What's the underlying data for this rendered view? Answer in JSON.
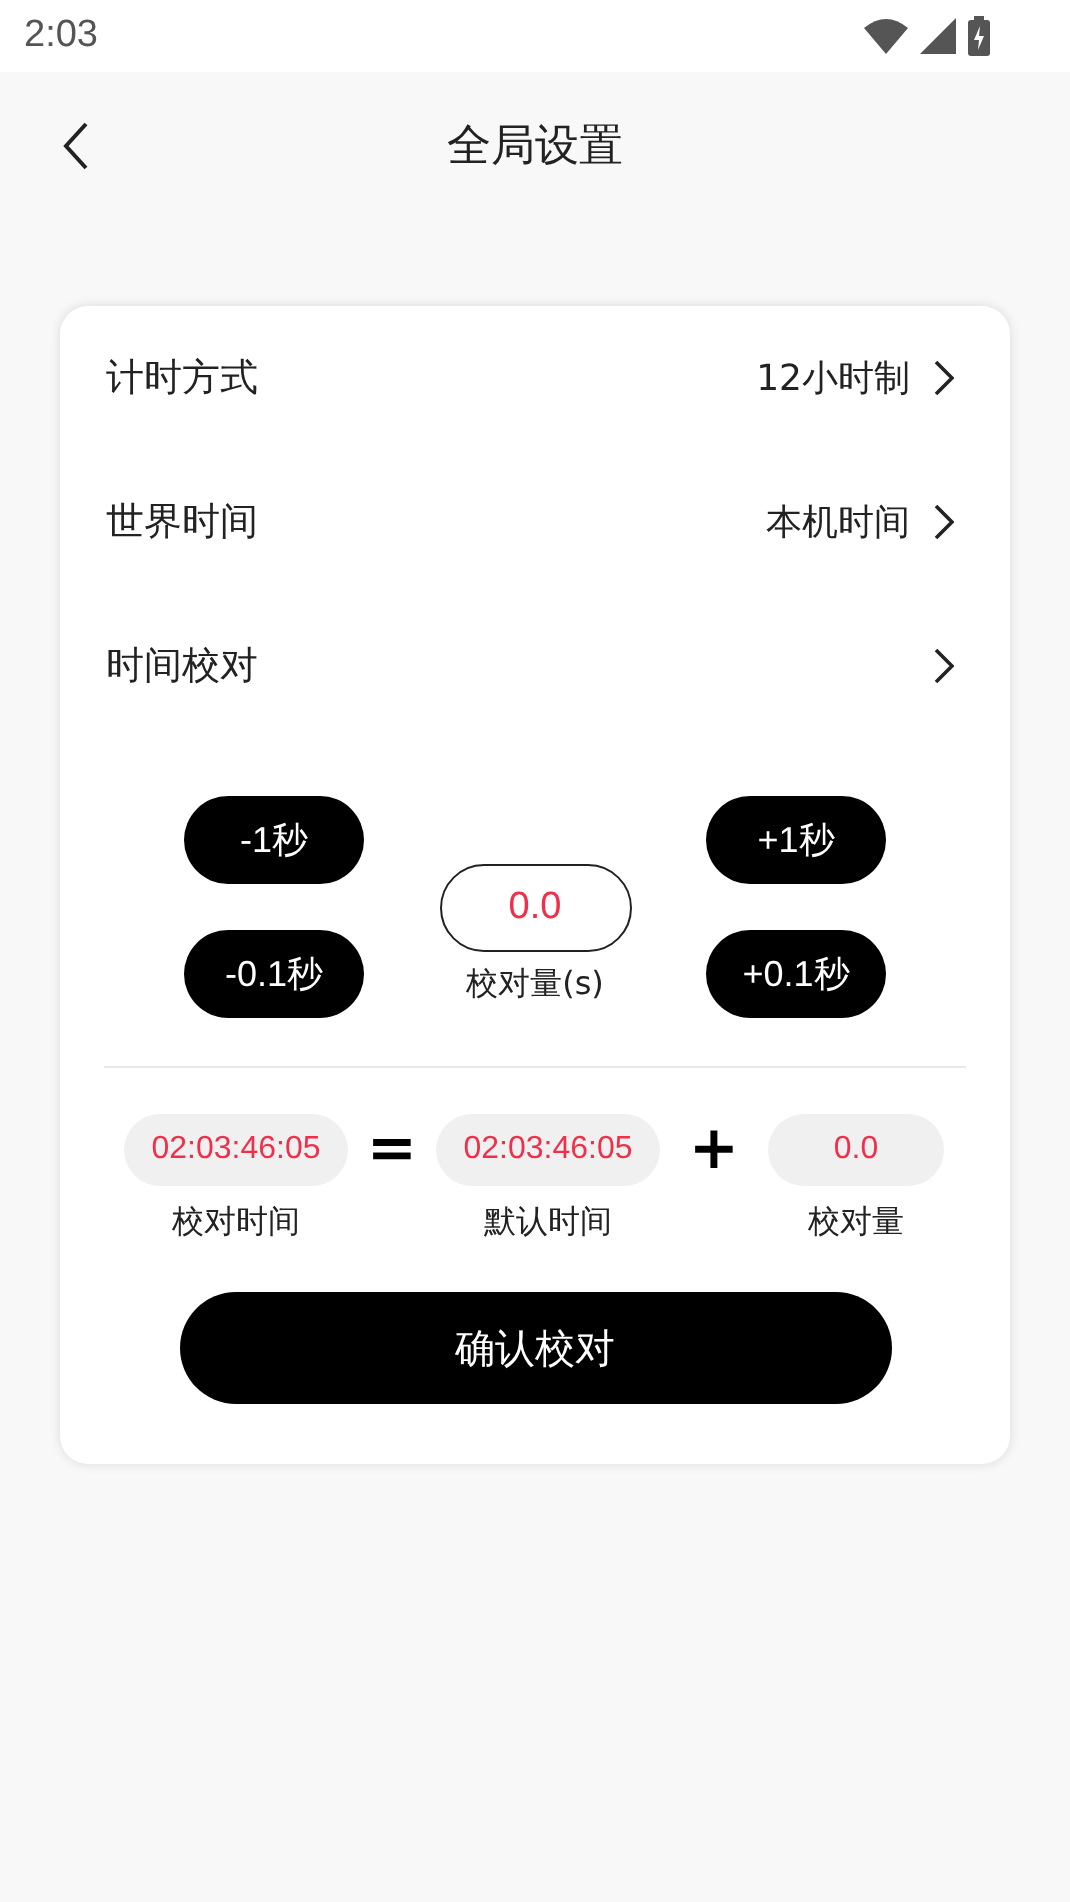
{
  "status_bar": {
    "time": "2:03"
  },
  "header": {
    "title": "全局设置"
  },
  "settings": [
    {
      "label": "计时方式",
      "value": "12小时制"
    },
    {
      "label": "世界时间",
      "value": "本机时间"
    },
    {
      "label": "时间校对"
    }
  ],
  "adjust": {
    "left_buttons": [
      "-1秒",
      "-0.1秒"
    ],
    "right_buttons": [
      "+1秒",
      "+0.1秒"
    ],
    "offset_value": "0.0",
    "offset_label": "校对量(s)"
  },
  "formula": {
    "items": [
      {
        "value": "02:03:46:05",
        "label": "校对时间"
      },
      {
        "value": "02:03:46:05",
        "label": "默认时间"
      },
      {
        "value": "0.0",
        "label": "校对量"
      }
    ],
    "operators": [
      "=",
      "+"
    ]
  },
  "confirm_button": "确认校对"
}
